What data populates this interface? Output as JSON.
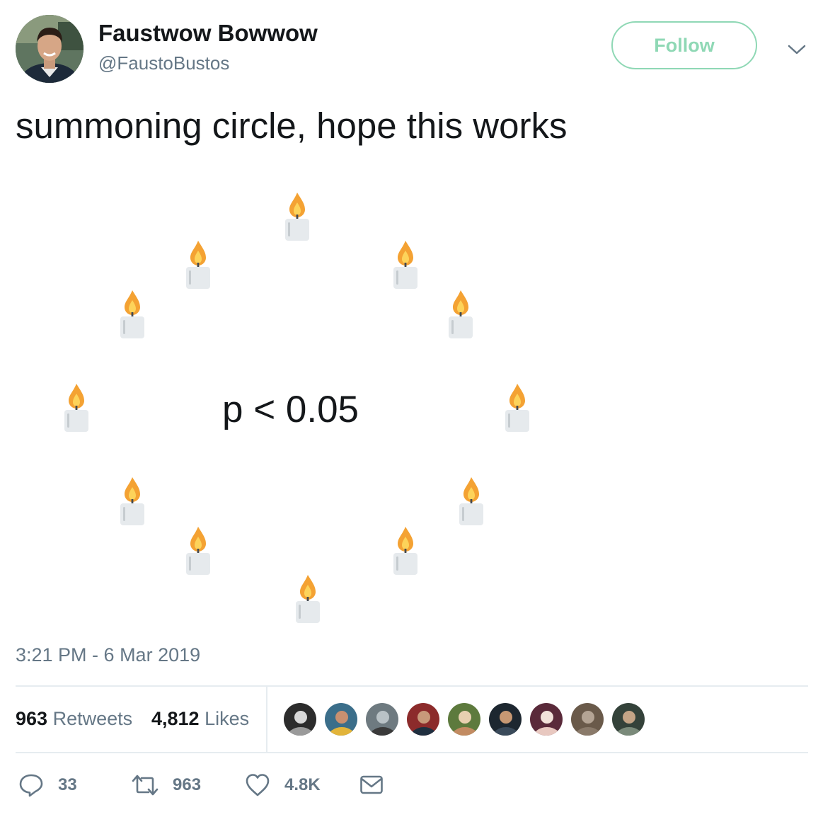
{
  "tweet": {
    "display_name": "Faustwow Bowwow",
    "handle": "@FaustoBustos",
    "follow_label": "Follow",
    "text": "summoning circle, hope this works",
    "center_formula": "p < 0.05",
    "candle_emoji": "🕯️",
    "candle_count": 12,
    "timestamp": "3:21 PM - 6 Mar 2019"
  },
  "stats": {
    "retweets_count": "963",
    "retweets_label": "Retweets",
    "likes_count": "4,812",
    "likes_label": "Likes",
    "liker_avatars": 9
  },
  "actions": {
    "reply_count": "33",
    "retweet_count": "963",
    "like_count": "4.8K"
  },
  "colors": {
    "follow_accent": "#8fd8b5",
    "secondary_text": "#657786",
    "primary_text": "#14171a",
    "divider": "#e6ecf0"
  }
}
